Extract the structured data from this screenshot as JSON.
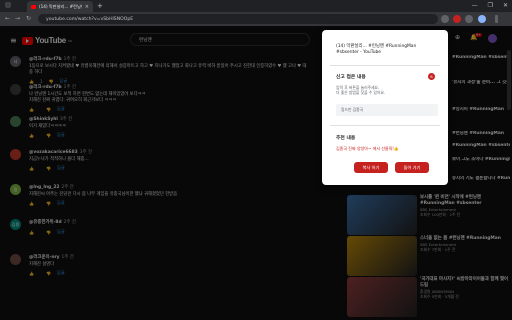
{
  "browser": {
    "tab_title": "(14) 막판살리... #런닝맨 #Runni...",
    "tab_close": "×",
    "new_tab": "+",
    "url": "youtube.com/watch?v=vSbHlSNOOpE",
    "min": "—",
    "max": "❐",
    "close": "✕",
    "back": "←",
    "forward": "→",
    "reload": "↻"
  },
  "youtube": {
    "logo": "YouTube",
    "logo_region": "KR",
    "search_value": "런닝맨",
    "notif_count": "9+",
    "comments": [
      {
        "author": "@러크-rdu-f7b",
        "time": "1주 전",
        "text": "1등으로 보시다 지켜봤네 ♥ 유병욱해전에 의해서 설증마트고 하고 ♥ 지나가도 했었고 화나고 유력 비하 받았어 주시고 진한대 인증하였수 ♥ 했 고나 ♥ 대중 하다",
        "likes": "1",
        "color": "#5f6368",
        "initial": "사"
      },
      {
        "author": "@러크-rdu-f7b",
        "time": "1주 전",
        "text": "나 런닝맨 1시간도 보적 하면 현변도 없는데 재미있었어 보다ㅋㅋ\n지해진 진짜 귀엽다. 귀여오히 회근거보다 ㅋㅋㅋ",
        "likes": "",
        "color": "#3d3d3d",
        "initial": ""
      },
      {
        "author": "@ShinkSyhl",
        "time": "3주 전",
        "text": "이거 재밌다ㅋㅋㅋㅋ",
        "likes": "",
        "color": "#4a7c59",
        "initial": ""
      },
      {
        "author": "@vozakacarice6683",
        "time": "3주 전",
        "text": "지금누나가 적적하니 몰더 해줌...",
        "likes": "",
        "color": "#c0392b",
        "initial": ""
      },
      {
        "author": "@lng_lng_22",
        "time": "2주 전",
        "text": "지해진씨 아주는 진당관 다시 봄 나무 게임을 유종국님이한 했냐 귀해졌었던 한받음",
        "likes": "",
        "color": "#7cb342",
        "initial": "링"
      },
      {
        "author": "@유종한가위-8d",
        "time": "2주 전",
        "text": "",
        "likes": "",
        "color": "#00897b",
        "initial": "김종"
      },
      {
        "author": "@러크운의-nry",
        "time": "1주 전",
        "text": "지해진 설명다",
        "likes": "",
        "color": "#6d4c41",
        "initial": ""
      }
    ],
    "reply_label": "답글",
    "side_videos": [
      {
        "title": "보시를 '퀸 비연' 시작에 #런닝맨 #RunningMan #sbsenter",
        "channel": "SBS Entertainment",
        "meta": "조회수 100만회 · 2주 전"
      },
      {
        "title": "스너을 없는 몸 #런닝맨 #RunningMan",
        "channel": "SBS Entertainment",
        "meta": "조회수 7만회 · 1주 전"
      },
      {
        "title": "'국가대표 마사지?' 씨방마라이어들과 함께 찢어드림",
        "channel": "환경원 J0B0N3M4N",
        "meta": "조회수 5만회 · 5개월 전"
      }
    ],
    "side_top_titles": [
      "#RunningMan #sbsenter ...",
      "'유시의 과정'을 준비... 그 깃은 제 가정의 ...",
      "#잉시미 #RunningMan",
      "#런닝맨 #RunningMan",
      "#RunningMan #sbsenter",
      "보이 그도 조이다 #RunningMan #sbsenter",
      "유시의 기도 결혼합니다 #RunningMan"
    ]
  },
  "popup": {
    "title": "(14) 막판살리... #런닝맨 #RunningMan #sbsenter - YouTube",
    "section1_title": "신고 접은 내용",
    "section1_count": "8",
    "section1_desc": "입력 후 버튼을 눌러주세요.\n더 좋은 방법을 찾을 수 있어요.",
    "input_placeholder": "링드만 김종국",
    "section2_title": "추천 내용",
    "section2_text": "김종국 진짜 양양아~ 에서 선물줘!👍",
    "btn_copy": "복사 하기",
    "btn_go": "들어 가기"
  }
}
